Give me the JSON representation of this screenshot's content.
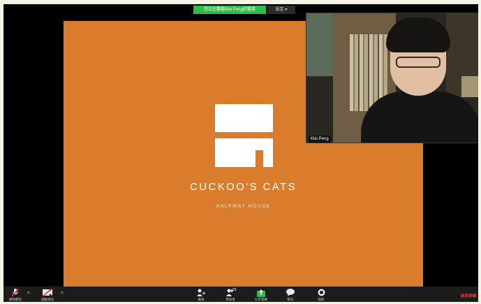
{
  "share_banner": {
    "label": "您正在觀看Klio Peng的螢幕",
    "options_label": "設定 ▾"
  },
  "slide": {
    "title": "CUCKOO'S CATS",
    "subtitle": "HALFWAY HOUSE",
    "background_color": "#d97d2c"
  },
  "video": {
    "participant_name": "Klio Peng"
  },
  "toolbar": {
    "items": [
      {
        "icon": "mic-muted-icon",
        "label": "解除靜音"
      },
      {
        "icon": "video-off-icon",
        "label": "啟動視訊"
      },
      {
        "icon": "invite-icon",
        "label": "邀請"
      },
      {
        "icon": "participants-icon",
        "label": "參與者",
        "count": "23"
      },
      {
        "icon": "share-screen-icon",
        "label": "分享螢幕"
      },
      {
        "icon": "chat-icon",
        "label": "聊天"
      },
      {
        "icon": "record-icon",
        "label": "錄影"
      }
    ],
    "end_label": "結束會議",
    "accent_color": "#2dbd48",
    "end_color": "#e23a3a"
  }
}
